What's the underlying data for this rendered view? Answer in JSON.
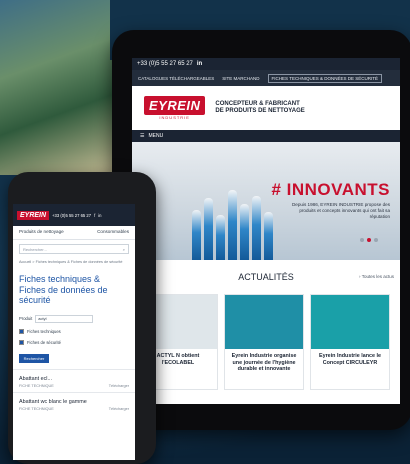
{
  "tablet": {
    "phone_line": "+33 (0)5 55 27 65 27",
    "social": "in",
    "links": [
      "CATALOGUES TÉLÉCHARGEABLES",
      "SITE MARCHAND",
      "FICHES TECHNIQUES & DONNÉES DE SÉCURITÉ"
    ],
    "logo": "EYREIN",
    "logo_sub": "INDUSTRIE",
    "tagline_1": "CONCEPTEUR & FABRICANT",
    "tagline_2": "DE PRODUITS DE NETTOYAGE",
    "menu": "MENU",
    "hero_title": "# INNOVANTS",
    "hero_text": "Depuis 1986, EYREIN INDUSTRIE propose des produits et concepts innovants qui ont fait sa réputation",
    "news_title": "ACTUALITÉS",
    "all_news": "Toutes les actus",
    "cards": [
      {
        "text": "ACTYL N obtient l'ECOLABEL",
        "img_color": "#dfe6ea"
      },
      {
        "text": "Eyrein Industrie organise une journée de l'hygiène durable et innovante",
        "img_color": "#1f8fa6"
      },
      {
        "text": "Eyrein Industrie lance le Concept CIRCULEYR",
        "img_color": "#1aa0a8"
      }
    ]
  },
  "phone": {
    "logo": "EYREIN",
    "phone_line": "+33 (0)5 55 27 65 27",
    "nav_left": "Produits de nettoyage",
    "nav_right": "Consommables",
    "search_placeholder": "Rechercher...",
    "breadcrumb": "Accueil  >  Fiches techniques & Fiches de données de sécurité",
    "title": "Fiches techniques & Fiches de données de sécurité",
    "field_label": "Produit",
    "field_value": "actyl",
    "check_1": "Fiches techniques",
    "check_2": "Fiches de sécurité",
    "button": "Rechercher",
    "items": [
      {
        "title": "Abattant ecl...",
        "sub": "FICHE TECHNIQUE",
        "action": "Télécharger"
      },
      {
        "title": "Abattant wc blanc le gamme",
        "sub": "FICHE TECHNIQUE",
        "action": "Télécharger"
      }
    ]
  },
  "colors": {
    "brand_red": "#c8102e",
    "navy": "#1b2433",
    "link_blue": "#1e55a5"
  }
}
